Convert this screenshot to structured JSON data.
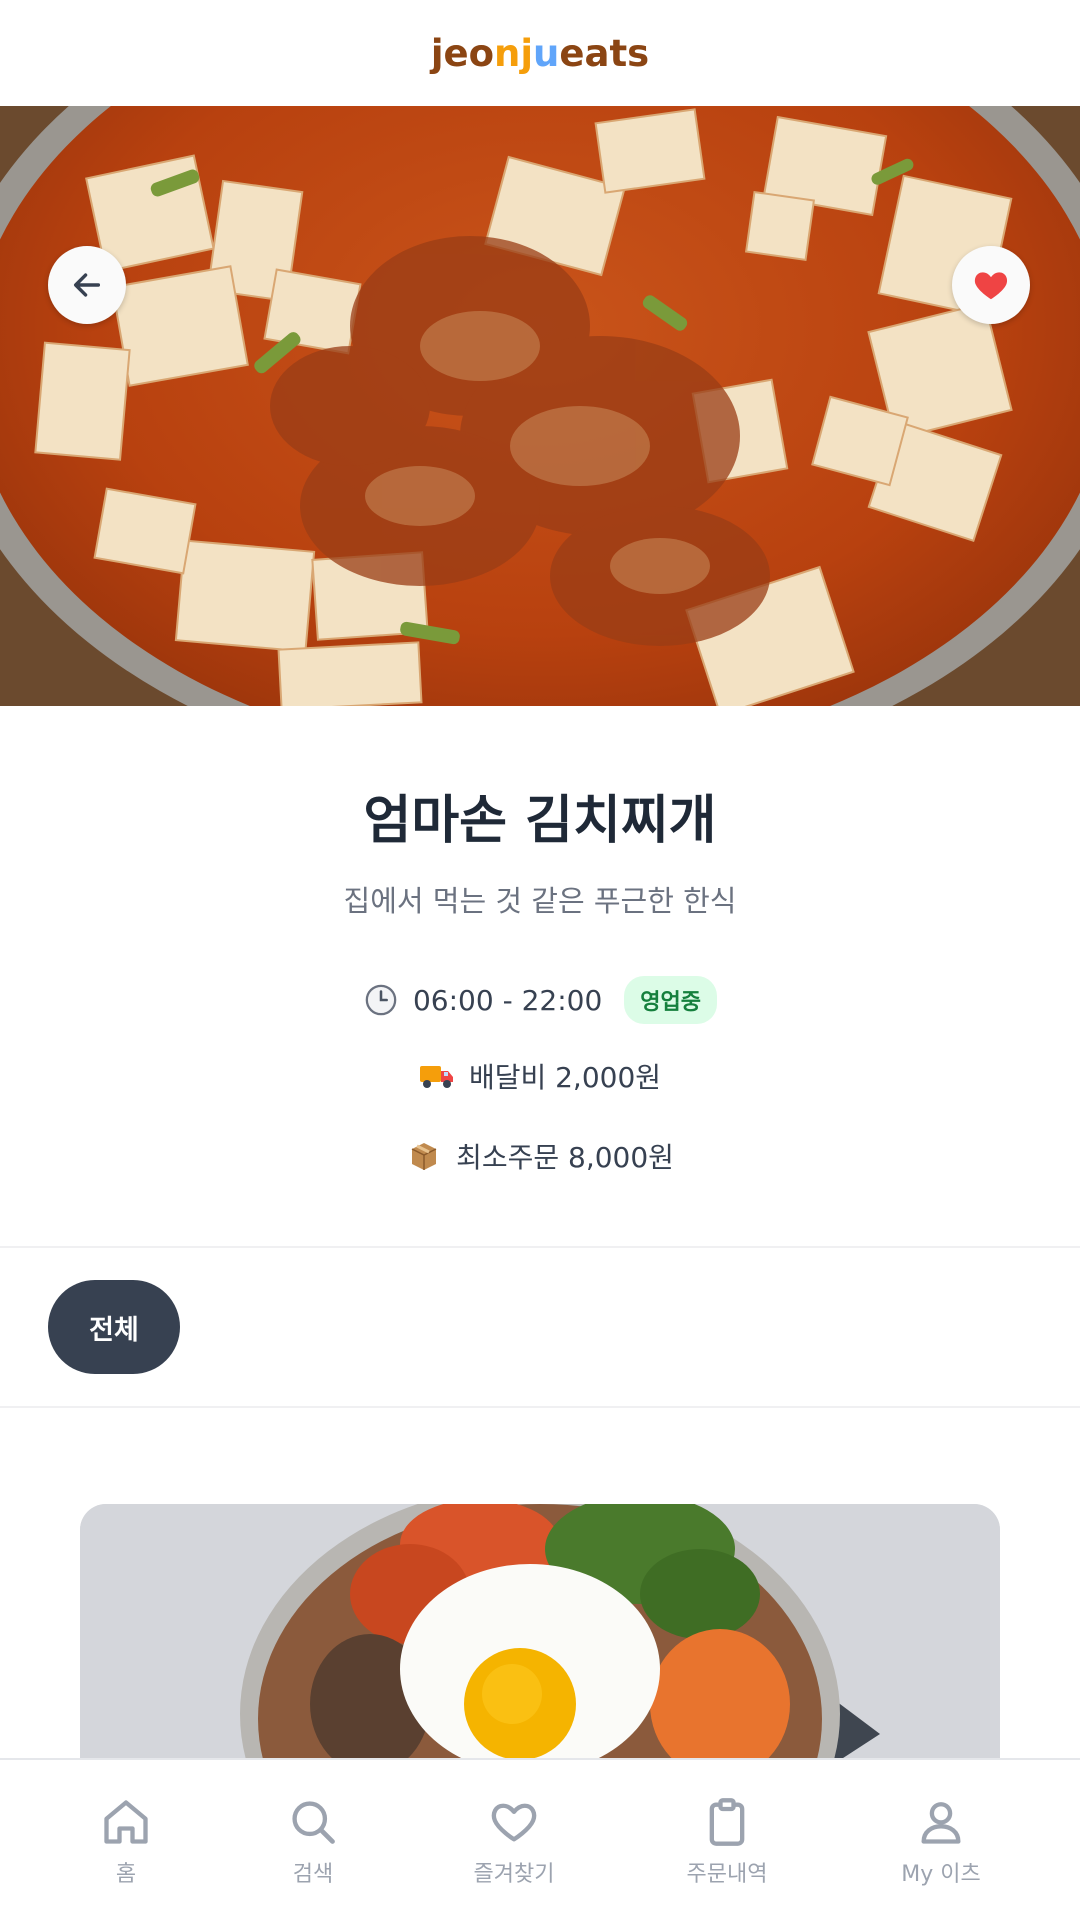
{
  "header": {
    "logo_parts": [
      "jeo",
      "n",
      "j",
      "u",
      "eats"
    ]
  },
  "restaurant": {
    "name": "엄마손 김치찌개",
    "description": "집에서 먹는 것 같은 푸근한 한식",
    "hours": "06:00 - 22:00",
    "status_badge": "영업중",
    "delivery_fee": "배달비 2,000원",
    "min_order": "최소주문 8,000원"
  },
  "categories": [
    {
      "label": "전체",
      "selected": true
    }
  ],
  "nav": {
    "items": [
      {
        "label": "홈",
        "icon": "home-icon"
      },
      {
        "label": "검색",
        "icon": "search-icon"
      },
      {
        "label": "즐겨찾기",
        "icon": "heart-icon"
      },
      {
        "label": "주문내역",
        "icon": "clipboard-icon"
      },
      {
        "label": "My 이츠",
        "icon": "user-icon"
      }
    ]
  },
  "colors": {
    "brand_brown": "#8b4513",
    "brand_orange": "#f59e0b",
    "brand_blue": "#60a5fa",
    "chip_bg": "#374151",
    "badge_bg": "#dcfce7",
    "badge_text": "#15803d",
    "favorite_red": "#ef4444"
  }
}
